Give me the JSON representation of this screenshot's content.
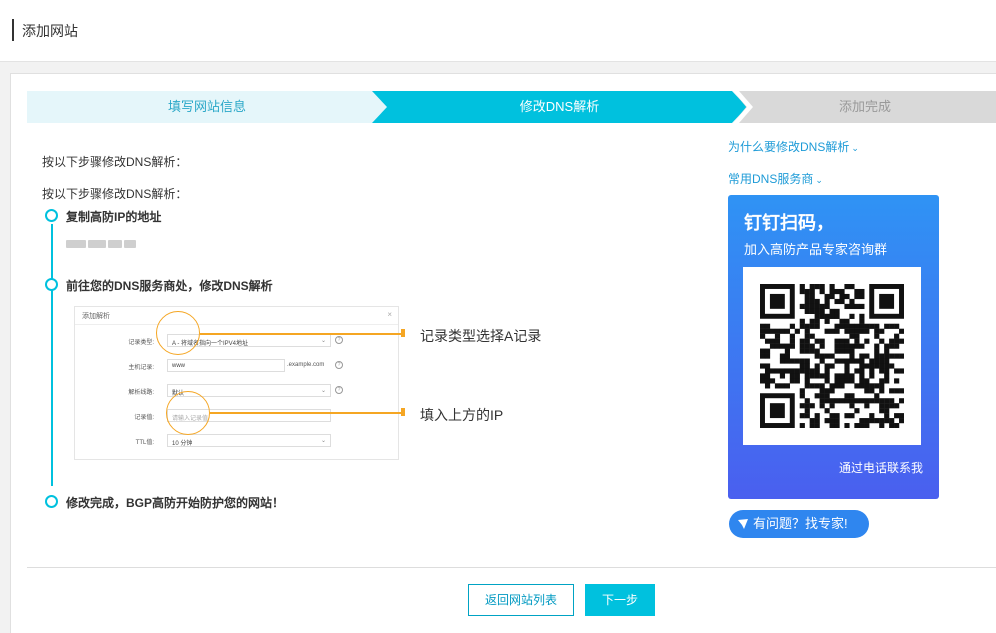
{
  "header": {
    "title": "添加网站"
  },
  "steps": [
    {
      "label": "填写网站信息",
      "state": "done"
    },
    {
      "label": "修改DNS解析",
      "state": "active"
    },
    {
      "label": "添加完成",
      "state": "pending"
    }
  ],
  "intro": {
    "line1": "按以下步骤修改DNS解析：",
    "line2": "按以下步骤修改DNS解析："
  },
  "timeline": {
    "step1": "复制高防IP的地址",
    "step2": "前往您的DNS服务商处，修改DNS解析",
    "step3": "修改完成，BGP高防开始防护您的网站！"
  },
  "mock_dialog": {
    "title": "添加解析",
    "close": "×",
    "rows": [
      {
        "label": "记录类型:",
        "value": "A - 将域名指向一个IPV4地址",
        "placeholder": false,
        "help": true
      },
      {
        "label": "主机记录:",
        "value": "www",
        "suffix": ".example.com",
        "placeholder": false,
        "help": true
      },
      {
        "label": "解析线路:",
        "value": "默认",
        "placeholder": false,
        "help": true
      },
      {
        "label": "记录值:",
        "value": "请输入记录值",
        "placeholder": true,
        "help": false
      },
      {
        "label": "TTL值:",
        "value": "10 分钟",
        "placeholder": false,
        "help": false
      }
    ]
  },
  "callouts": {
    "record_type": "记录类型选择A记录",
    "fill_ip": "填入上方的IP"
  },
  "sidebar": {
    "why_link": "为什么要修改DNS解析",
    "providers_link": "常用DNS服务商",
    "promo": {
      "title": "钉钉扫码，",
      "subtitle": "加入高防产品专家咨询群",
      "phone": "通过电话联系我"
    },
    "expert_button": "有问题？找专家!"
  },
  "footer": {
    "back_button": "返回网站列表",
    "next_button": "下一步"
  },
  "colors": {
    "accent": "#00c1de",
    "link": "#1e9bd7",
    "callout": "#f5a623",
    "promo_top": "#2f93f4",
    "promo_bottom": "#4a5fef"
  }
}
